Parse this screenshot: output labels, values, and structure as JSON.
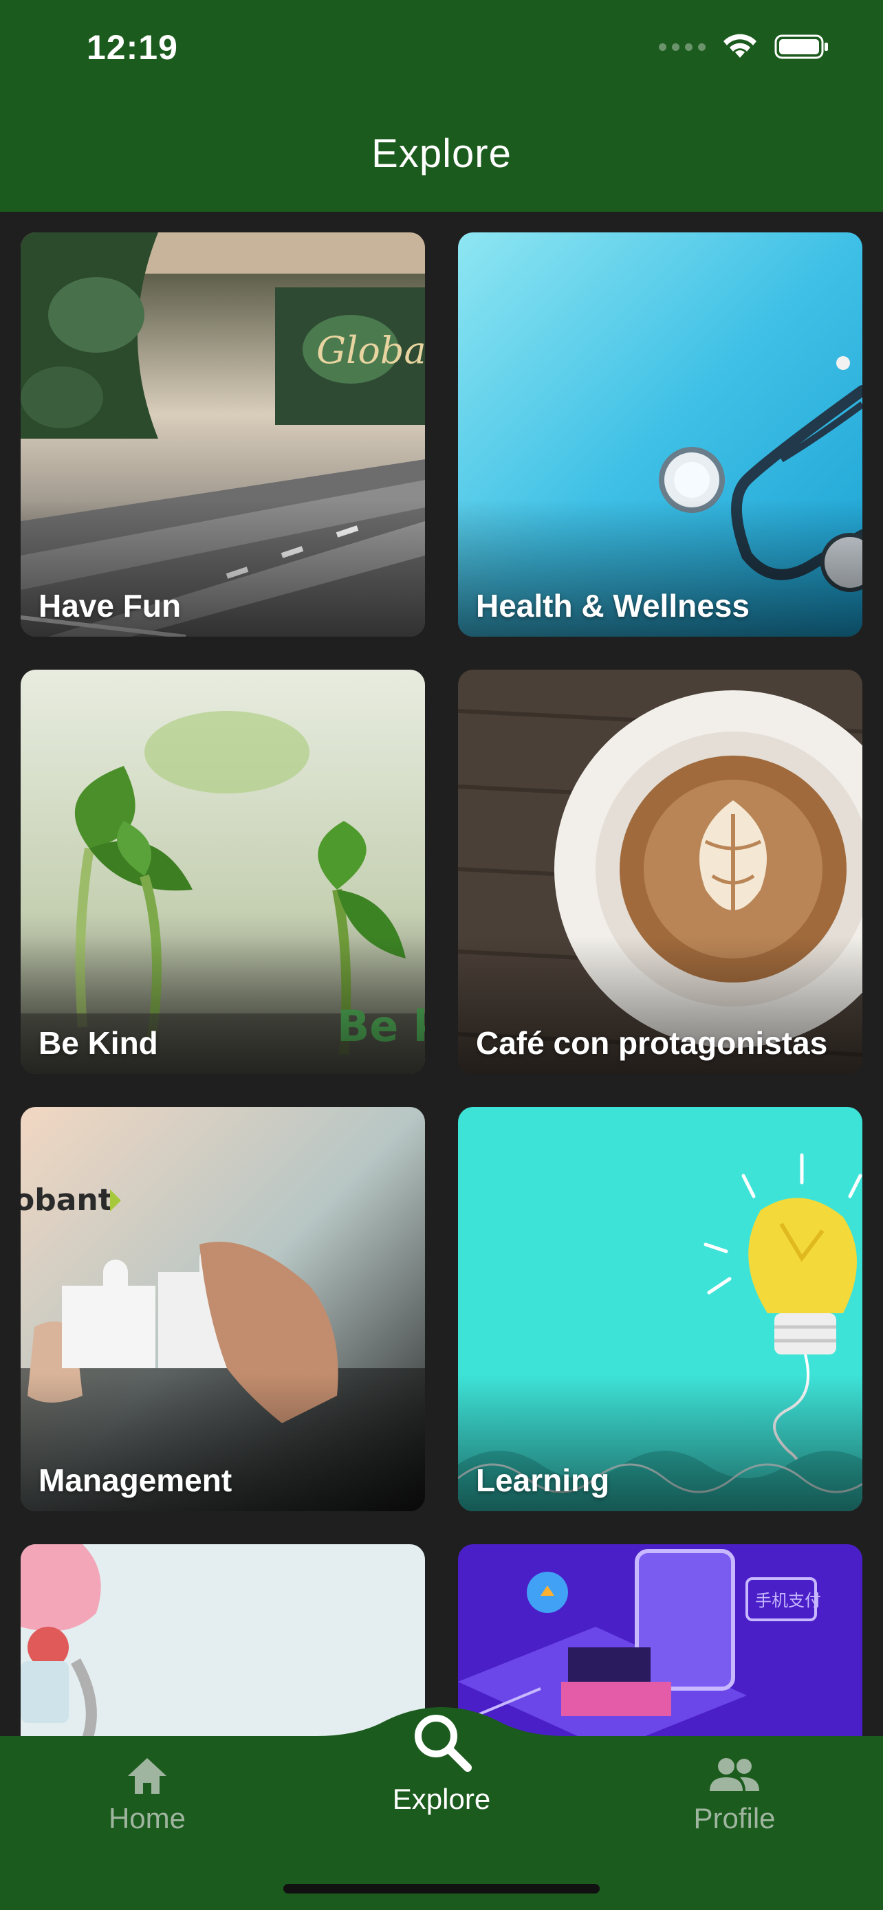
{
  "status_bar": {
    "time": "12:19",
    "icons": [
      "signal-icon",
      "wifi-icon",
      "battery-icon"
    ]
  },
  "header": {
    "title": "Explore"
  },
  "categories": [
    {
      "label": "Have Fun",
      "image": "bowling-alley-photo"
    },
    {
      "label": "Health & Wellness",
      "image": "stethoscope-photo"
    },
    {
      "label": "Be Kind",
      "image": "sprouting-plants-photo"
    },
    {
      "label": "Café con protagonistas",
      "image": "latte-art-photo"
    },
    {
      "label": "Management",
      "image": "puzzle-pieces-photo"
    },
    {
      "label": "Learning",
      "image": "lightbulb-illustration"
    },
    {
      "label": "",
      "image": "fitness-items-photo"
    },
    {
      "label": "",
      "image": "isometric-payment-illustration"
    }
  ],
  "nav": {
    "items": [
      {
        "label": "Home",
        "icon": "home-icon"
      },
      {
        "label": "Explore",
        "icon": "search-icon"
      },
      {
        "label": "Profile",
        "icon": "people-icon"
      }
    ],
    "active": "Explore"
  },
  "colors": {
    "brand_green": "#1c5b1e",
    "background": "#1f1f1f",
    "inactive_nav": "#9fb59f"
  }
}
